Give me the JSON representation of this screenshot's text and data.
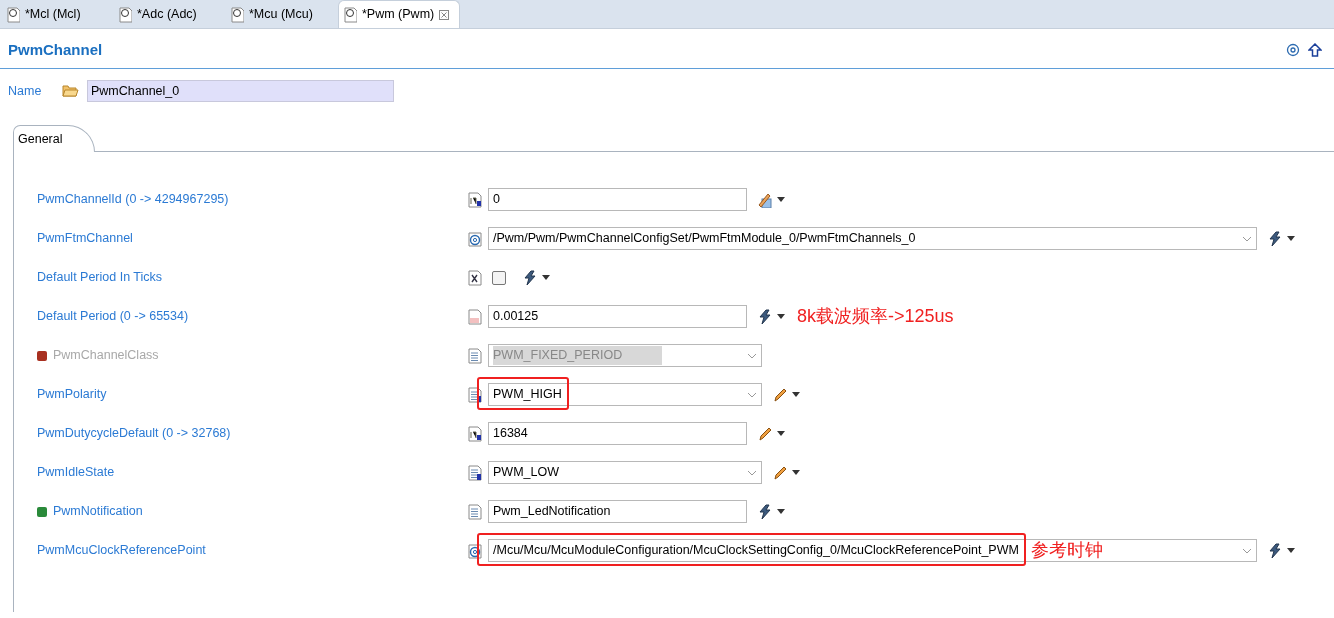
{
  "editor_tabs": [
    {
      "label": "*Mcl (Mcl)",
      "selected": false
    },
    {
      "label": "*Adc (Adc)",
      "selected": false
    },
    {
      "label": "*Mcu (Mcu)",
      "selected": false
    },
    {
      "label": "*Pwm (Pwm)",
      "selected": true
    }
  ],
  "title": "PwmChannel",
  "name_field": {
    "label": "Name",
    "value": "PwmChannel_0"
  },
  "form_tabs": [
    {
      "label": "General",
      "selected": true
    }
  ],
  "rows": [
    {
      "label": "PwmChannelId (0 -> 4294967295)",
      "kind": "integer",
      "value": "0",
      "calculated": true,
      "disabled": false,
      "highlighted": false
    },
    {
      "label": "PwmFtmChannel",
      "kind": "reference",
      "value": "/Pwm/Pwm/PwmChannelConfigSet/PwmFtmModule_0/PwmFtmChannels_0",
      "calculated": false,
      "user_defined": false,
      "disabled": false,
      "highlighted": false
    },
    {
      "label": "Default Period In Ticks",
      "kind": "boolean",
      "checked": false,
      "calculated": false,
      "user_defined": false,
      "disabled": false,
      "highlighted": false
    },
    {
      "label": "Default Period (0 -> 65534)",
      "kind": "float",
      "value": "0.00125",
      "calculated": false,
      "user_defined": false,
      "disabled": false,
      "highlighted": false,
      "note": "8k载波频率->125us"
    },
    {
      "label": "PwmChannelClass",
      "color": "#a83020",
      "kind": "enum",
      "value": "PWM_FIXED_PERIOD",
      "disabled": true,
      "highlighted": false
    },
    {
      "label": "PwmPolarity",
      "kind": "enum",
      "value": "PWM_HIGH",
      "calculated": false,
      "user_defined": true,
      "disabled": false,
      "highlighted": true
    },
    {
      "label": "PwmDutycycleDefault (0 -> 32768)",
      "kind": "integer",
      "value": "16384",
      "calculated": false,
      "user_defined": true,
      "disabled": false,
      "highlighted": false
    },
    {
      "label": "PwmIdleState",
      "kind": "enum",
      "value": "PWM_LOW",
      "calculated": false,
      "user_defined": true,
      "disabled": false,
      "highlighted": false
    },
    {
      "label": "PwmNotification",
      "color": "#2a8a3a",
      "kind": "string",
      "value": "Pwm_LedNotification",
      "calculated": false,
      "user_defined": false,
      "disabled": false,
      "highlighted": false
    },
    {
      "label": "PwmMcuClockReferencePoint",
      "kind": "reference",
      "value": "/Mcu/Mcu/McuModuleConfiguration/McuClockSettingConfig_0/McuClockReferencePoint_PWM",
      "calculated": false,
      "user_defined": false,
      "disabled": false,
      "highlighted": true,
      "note": "参考时钟"
    }
  ]
}
